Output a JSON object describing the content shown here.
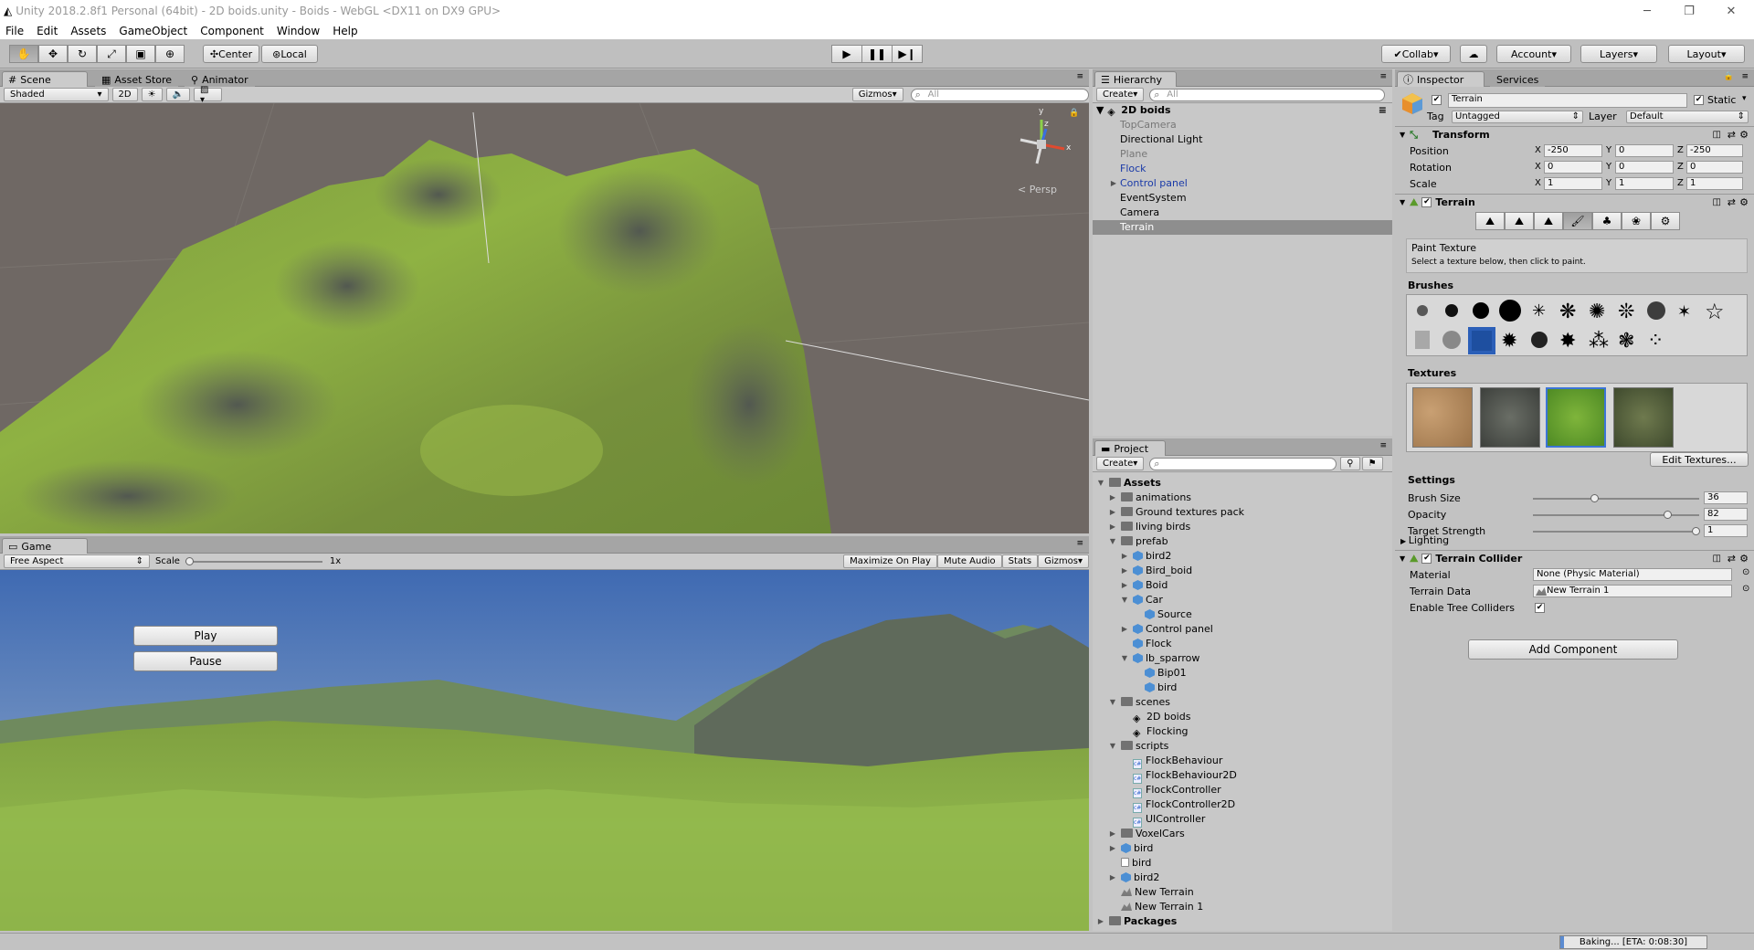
{
  "window": {
    "title": "Unity 2018.2.8f1 Personal (64bit) - 2D boids.unity - Boids - WebGL <DX11 on DX9 GPU>"
  },
  "menu": [
    "File",
    "Edit",
    "Assets",
    "GameObject",
    "Component",
    "Window",
    "Help"
  ],
  "toolbar": {
    "center": "Center",
    "local": "Local",
    "collab": "Collab",
    "account": "Account",
    "layers": "Layers",
    "layout": "Layout"
  },
  "scene": {
    "tabs": [
      "Scene",
      "Asset Store",
      "Animator"
    ],
    "shading": "Shaded",
    "btn_2d": "2D",
    "gizmos": "Gizmos",
    "search_placeholder": "All",
    "persp": "Persp",
    "gizmo_axes": {
      "y": "y",
      "z": "z",
      "x": "x"
    }
  },
  "game": {
    "tab": "Game",
    "aspect": "Free Aspect",
    "scale_label": "Scale",
    "scale_value": "1x",
    "maximize": "Maximize On Play",
    "mute": "Mute Audio",
    "stats": "Stats",
    "gizmos": "Gizmos",
    "play_button": "Play",
    "pause_button": "Pause"
  },
  "hierarchy": {
    "tab": "Hierarchy",
    "create": "Create",
    "search_placeholder": "All",
    "scene_name": "2D boids",
    "items": [
      "TopCamera",
      "Directional Light",
      "Plane",
      "Flock",
      "Control panel",
      "EventSystem",
      "Camera",
      "Terrain"
    ]
  },
  "project": {
    "tab": "Project",
    "create": "Create",
    "tree": [
      {
        "label": "Assets",
        "depth": 0,
        "icon": "folder",
        "open": true,
        "bold": true
      },
      {
        "label": "animations",
        "depth": 1,
        "icon": "folder",
        "arrow": "closed"
      },
      {
        "label": "Ground textures pack",
        "depth": 1,
        "icon": "folder",
        "arrow": "closed"
      },
      {
        "label": "living birds",
        "depth": 1,
        "icon": "folder",
        "arrow": "closed"
      },
      {
        "label": "prefab",
        "depth": 1,
        "icon": "folder",
        "arrow": "open"
      },
      {
        "label": "bird2",
        "depth": 2,
        "icon": "prefab",
        "arrow": "closed"
      },
      {
        "label": "Bird_boid",
        "depth": 2,
        "icon": "prefab",
        "arrow": "closed"
      },
      {
        "label": "Boid",
        "depth": 2,
        "icon": "prefab",
        "arrow": "closed"
      },
      {
        "label": "Car",
        "depth": 2,
        "icon": "prefab",
        "arrow": "open"
      },
      {
        "label": "Source",
        "depth": 3,
        "icon": "prefab"
      },
      {
        "label": "Control panel",
        "depth": 2,
        "icon": "prefab",
        "arrow": "closed"
      },
      {
        "label": "Flock",
        "depth": 2,
        "icon": "prefab"
      },
      {
        "label": "lb_sparrow",
        "depth": 2,
        "icon": "prefab",
        "arrow": "open"
      },
      {
        "label": "Bip01",
        "depth": 3,
        "icon": "prefab"
      },
      {
        "label": "bird",
        "depth": 3,
        "icon": "prefab"
      },
      {
        "label": "scenes",
        "depth": 1,
        "icon": "folder",
        "arrow": "open"
      },
      {
        "label": "2D boids",
        "depth": 2,
        "icon": "scene"
      },
      {
        "label": "Flocking",
        "depth": 2,
        "icon": "scene"
      },
      {
        "label": "scripts",
        "depth": 1,
        "icon": "folder",
        "arrow": "open"
      },
      {
        "label": "FlockBehaviour",
        "depth": 2,
        "icon": "script"
      },
      {
        "label": "FlockBehaviour2D",
        "depth": 2,
        "icon": "script"
      },
      {
        "label": "FlockController",
        "depth": 2,
        "icon": "script"
      },
      {
        "label": "FlockController2D",
        "depth": 2,
        "icon": "script"
      },
      {
        "label": "UIController",
        "depth": 2,
        "icon": "script"
      },
      {
        "label": "VoxelCars",
        "depth": 1,
        "icon": "folder",
        "arrow": "closed"
      },
      {
        "label": "bird",
        "depth": 1,
        "icon": "prefab",
        "arrow": "closed"
      },
      {
        "label": "bird",
        "depth": 1,
        "icon": "file"
      },
      {
        "label": "bird2",
        "depth": 1,
        "icon": "prefab",
        "arrow": "closed"
      },
      {
        "label": "New Terrain",
        "depth": 1,
        "icon": "terrain"
      },
      {
        "label": "New Terrain 1",
        "depth": 1,
        "icon": "terrain"
      },
      {
        "label": "Packages",
        "depth": 0,
        "icon": "folder",
        "arrow": "closed",
        "bold": true
      }
    ]
  },
  "inspector": {
    "tabs": [
      "Inspector",
      "Services"
    ],
    "object_name": "Terrain",
    "static": "Static",
    "tag_label": "Tag",
    "tag": "Untagged",
    "layer_label": "Layer",
    "layer": "Default",
    "transform": {
      "title": "Transform",
      "rows": [
        {
          "label": "Position",
          "x": "-250",
          "y": "0",
          "z": "-250"
        },
        {
          "label": "Rotation",
          "x": "0",
          "y": "0",
          "z": "0"
        },
        {
          "label": "Scale",
          "x": "1",
          "y": "1",
          "z": "1"
        }
      ]
    },
    "terrain": {
      "title": "Terrain",
      "paint_title": "Paint Texture",
      "paint_hint": "Select a texture below, then click to paint.",
      "brushes_label": "Brushes",
      "textures_label": "Textures",
      "edit_textures": "Edit Textures...",
      "settings_label": "Settings",
      "settings": [
        {
          "label": "Brush Size",
          "value": "36",
          "pos": 0.36
        },
        {
          "label": "Opacity",
          "value": "82",
          "pos": 0.82
        },
        {
          "label": "Target Strength",
          "value": "1",
          "pos": 1.0
        }
      ],
      "lighting": "Lighting"
    },
    "collider": {
      "title": "Terrain Collider",
      "material_label": "Material",
      "material": "None (Physic Material)",
      "data_label": "Terrain Data",
      "data": "New Terrain 1",
      "trees_label": "Enable Tree Colliders"
    },
    "add_component": "Add Component"
  },
  "status": {
    "baking": "Baking... [ETA: 0:08:30]"
  }
}
